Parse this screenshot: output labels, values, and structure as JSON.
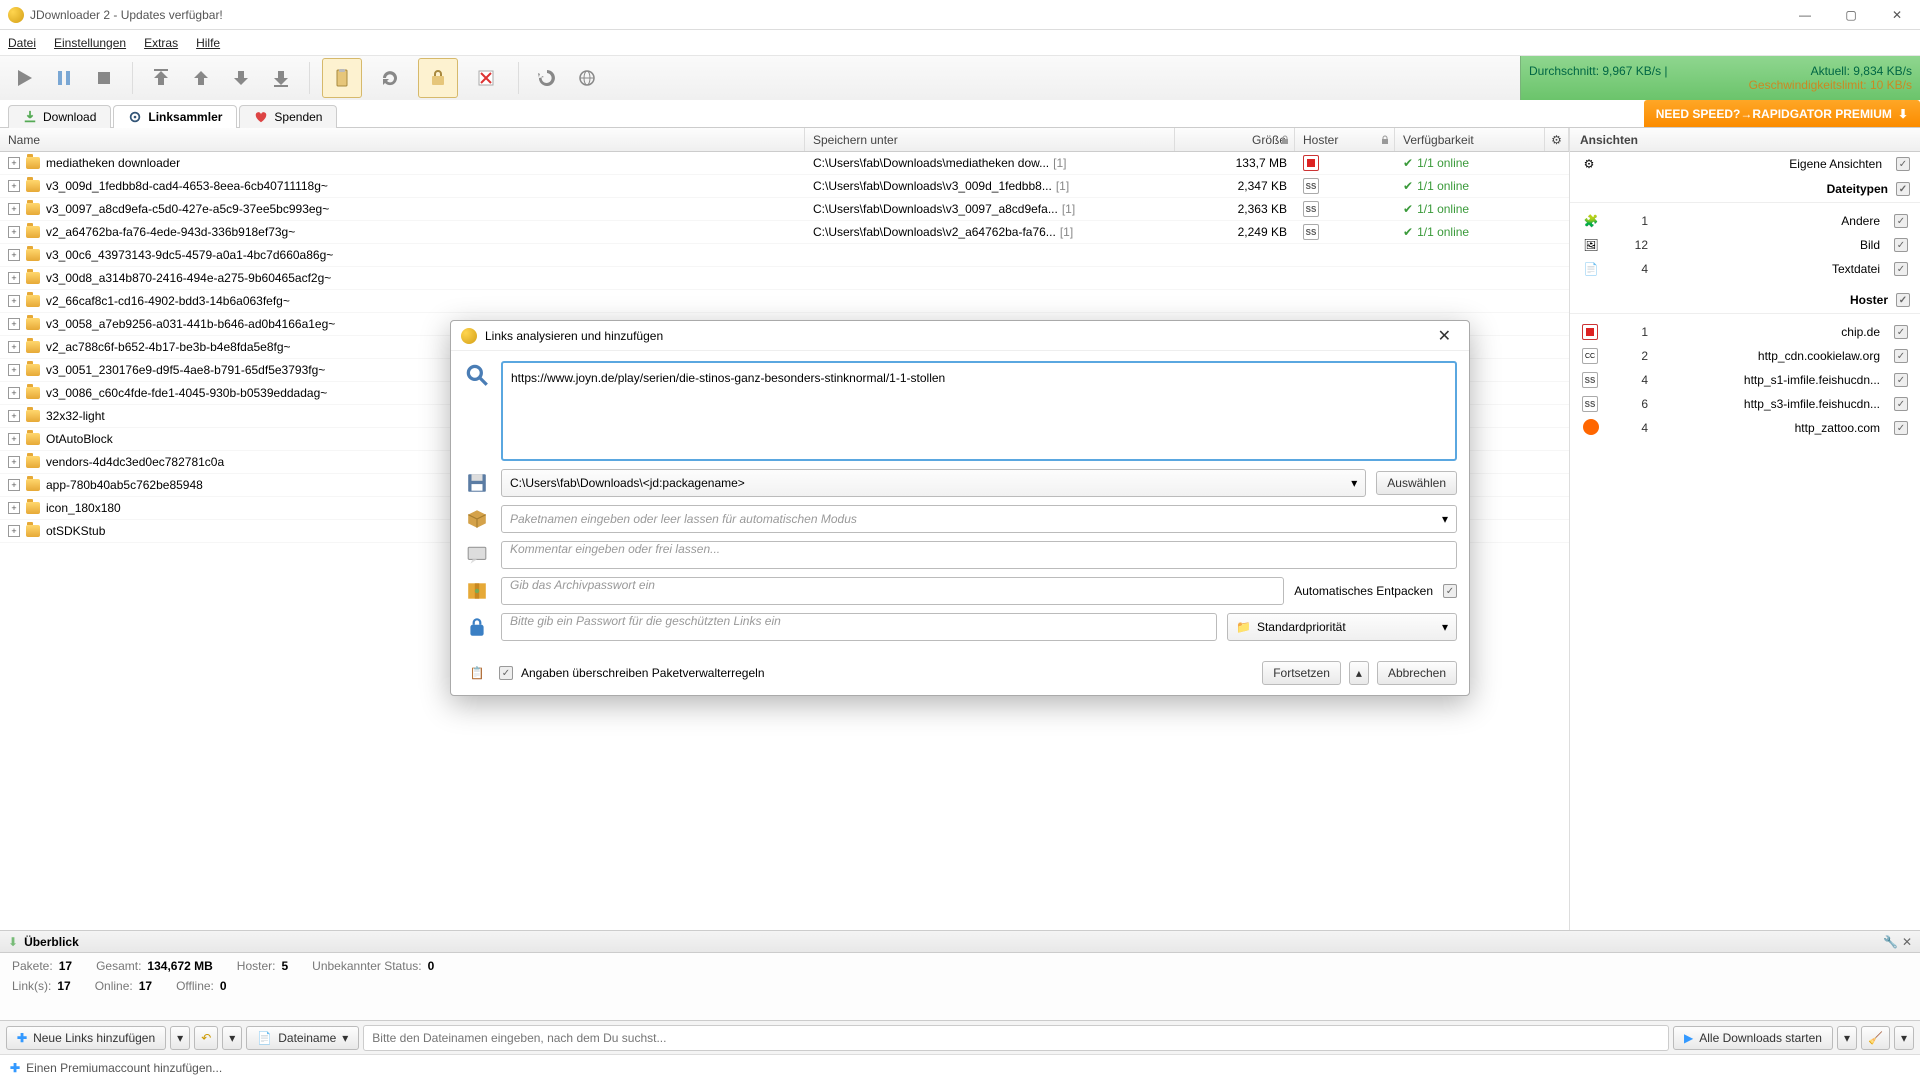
{
  "window": {
    "title": "JDownloader 2 - Updates verfügbar!"
  },
  "menubar": {
    "items": [
      "Datei",
      "Einstellungen",
      "Extras",
      "Hilfe"
    ]
  },
  "speed": {
    "avg_label": "Durchschnitt:",
    "avg_value": "9,967 KB/s",
    "now_label": "Aktuell:",
    "now_value": "9,834 KB/s",
    "limit_label": "Geschwindigkeitslimit:",
    "limit_value": "10 KB/s"
  },
  "tabs": {
    "download": "Download",
    "linkgrabber": "Linksammler",
    "donate": "Spenden",
    "promo": "NEED SPEED?→RAPIDGATOR PREMIUM"
  },
  "columns": {
    "name": "Name",
    "path": "Speichern unter",
    "size": "Größe",
    "hoster": "Hoster",
    "avail": "Verfügbarkeit"
  },
  "rows": [
    {
      "name": "mediatheken downloader",
      "path": "C:\\Users\\fab\\Downloads\\mediatheken dow...",
      "count": "[1]",
      "size": "133,7 MB",
      "host": "red",
      "avail": "1/1 online"
    },
    {
      "name": "v3_009d_1fedbb8d-cad4-4653-8eea-6cb40711118g~",
      "path": "C:\\Users\\fab\\Downloads\\v3_009d_1fedbb8...",
      "count": "[1]",
      "size": "2,347 KB",
      "host": "ss",
      "avail": "1/1 online"
    },
    {
      "name": "v3_0097_a8cd9efa-c5d0-427e-a5c9-37ee5bc993eg~",
      "path": "C:\\Users\\fab\\Downloads\\v3_0097_a8cd9efa...",
      "count": "[1]",
      "size": "2,363 KB",
      "host": "ss",
      "avail": "1/1 online"
    },
    {
      "name": "v2_a64762ba-fa76-4ede-943d-336b918ef73g~",
      "path": "C:\\Users\\fab\\Downloads\\v2_a64762ba-fa76...",
      "count": "[1]",
      "size": "2,249 KB",
      "host": "ss",
      "avail": "1/1 online"
    },
    {
      "name": "v3_00c6_43973143-9dc5-4579-a0a1-4bc7d660a86g~",
      "path": "",
      "count": "",
      "size": "",
      "host": "",
      "avail": ""
    },
    {
      "name": "v3_00d8_a314b870-2416-494e-a275-9b60465acf2g~",
      "path": "",
      "count": "",
      "size": "",
      "host": "",
      "avail": ""
    },
    {
      "name": "v2_66caf8c1-cd16-4902-bdd3-14b6a063fefg~",
      "path": "",
      "count": "",
      "size": "",
      "host": "",
      "avail": ""
    },
    {
      "name": "v3_0058_a7eb9256-a031-441b-b646-ad0b4166a1eg~",
      "path": "",
      "count": "",
      "size": "",
      "host": "",
      "avail": ""
    },
    {
      "name": "v2_ac788c6f-b652-4b17-be3b-b4e8fda5e8fg~",
      "path": "",
      "count": "",
      "size": "",
      "host": "",
      "avail": ""
    },
    {
      "name": "v3_0051_230176e9-d9f5-4ae8-b791-65df5e3793fg~",
      "path": "",
      "count": "",
      "size": "",
      "host": "",
      "avail": ""
    },
    {
      "name": "v3_0086_c60c4fde-fde1-4045-930b-b0539eddadag~",
      "path": "",
      "count": "",
      "size": "",
      "host": "",
      "avail": ""
    },
    {
      "name": "32x32-light",
      "path": "",
      "count": "",
      "size": "",
      "host": "",
      "avail": ""
    },
    {
      "name": "OtAutoBlock",
      "path": "",
      "count": "",
      "size": "",
      "host": "",
      "avail": ""
    },
    {
      "name": "vendors-4d4dc3ed0ec782781c0a",
      "path": "",
      "count": "",
      "size": "",
      "host": "",
      "avail": ""
    },
    {
      "name": "app-780b40ab5c762be85948",
      "path": "",
      "count": "",
      "size": "",
      "host": "",
      "avail": ""
    },
    {
      "name": "icon_180x180",
      "path": "",
      "count": "",
      "size": "",
      "host": "",
      "avail": ""
    },
    {
      "name": "otSDKStub",
      "path": "",
      "count": "",
      "size": "",
      "host": "",
      "avail": ""
    }
  ],
  "side": {
    "title": "Ansichten",
    "custom_views": "Eigene Ansichten",
    "filetypes_title": "Dateitypen",
    "filetypes": [
      {
        "icon": "🧩",
        "count": "1",
        "label": "Andere"
      },
      {
        "icon": "🖼",
        "count": "12",
        "label": "Bild"
      },
      {
        "icon": "📄",
        "count": "4",
        "label": "Textdatei"
      }
    ],
    "hoster_title": "Hoster",
    "hosters": [
      {
        "icon": "red",
        "count": "1",
        "label": "chip.de"
      },
      {
        "icon": "cc",
        "count": "2",
        "label": "http_cdn.cookielaw.org"
      },
      {
        "icon": "ss",
        "count": "4",
        "label": "http_s1-imfile.feishucdn..."
      },
      {
        "icon": "ss",
        "count": "6",
        "label": "http_s3-imfile.feishucdn..."
      },
      {
        "icon": "o",
        "count": "4",
        "label": "http_zattoo.com"
      }
    ]
  },
  "overview": {
    "title": "Überblick",
    "stats": [
      {
        "k": "Pakete:",
        "v": "17"
      },
      {
        "k": "Gesamt:",
        "v": "134,672 MB"
      },
      {
        "k": "Hoster:",
        "v": "5"
      },
      {
        "k": "Unbekannter Status:",
        "v": "0"
      }
    ],
    "stats2": [
      {
        "k": "Link(s):",
        "v": "17"
      },
      {
        "k": "Online:",
        "v": "17"
      },
      {
        "k": "Offline:",
        "v": "0"
      }
    ]
  },
  "bottom": {
    "add_links": "Neue Links hinzufügen",
    "filename": "Dateiname",
    "search_placeholder": "Bitte den Dateinamen eingeben, nach dem Du suchst...",
    "start_all": "Alle Downloads starten"
  },
  "status": {
    "premium": "Einen Premiumaccount hinzufügen..."
  },
  "dialog": {
    "title": "Links analysieren und hinzufügen",
    "url": "https://www.joyn.de/play/serien/die-stinos-ganz-besonders-stinknormal/1-1-stollen",
    "save_path": "C:\\Users\\fab\\Downloads\\<jd:packagename>",
    "choose": "Auswählen",
    "package_ph": "Paketnamen eingeben oder leer lassen für automatischen Modus",
    "comment_ph": "Kommentar eingeben oder frei lassen...",
    "archive_ph": "Gib das Archivpasswort ein",
    "auto_extract": "Automatisches Entpacken",
    "password_ph": "Bitte gib ein Passwort für die geschützten Links ein",
    "priority": "Standardpriorität",
    "override": "Angaben überschreiben Paketverwalterregeln",
    "continue": "Fortsetzen",
    "cancel": "Abbrechen"
  }
}
